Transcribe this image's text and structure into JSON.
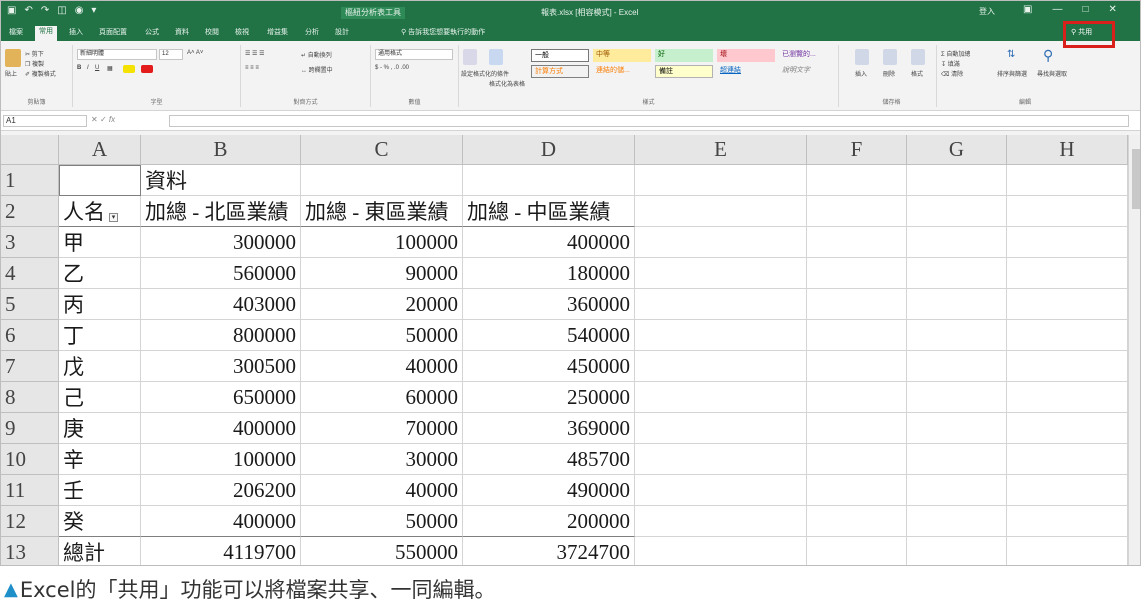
{
  "window": {
    "context_tab": "樞紐分析表工具",
    "title": "報表.xlsx [相容模式] - Excel",
    "user": "登入"
  },
  "tabs": [
    {
      "label": "檔案",
      "active": false
    },
    {
      "label": "常用",
      "active": true
    },
    {
      "label": "插入",
      "active": false
    },
    {
      "label": "頁面配置",
      "active": false
    },
    {
      "label": "公式",
      "active": false
    },
    {
      "label": "資料",
      "active": false
    },
    {
      "label": "校閱",
      "active": false
    },
    {
      "label": "檢視",
      "active": false
    },
    {
      "label": "增益集",
      "active": false
    },
    {
      "label": "分析",
      "active": false
    },
    {
      "label": "設計",
      "active": false
    }
  ],
  "tell_me": "告訴我您想要執行的動作",
  "share_label": "共用",
  "ribbon": {
    "groups": [
      "剪貼簿",
      "字型",
      "對齊方式",
      "數值",
      "樣式",
      "儲存格",
      "編輯"
    ],
    "font_name": "新細明體",
    "font_size": "12",
    "number_format": "通用格式",
    "styles": [
      "一般",
      "中等",
      "好",
      "壞",
      "已瀏覽的...",
      "計算方式",
      "連結的儲...",
      "備註",
      "超連結",
      "說明文字"
    ],
    "cut": "剪下",
    "copy": "複製",
    "format_painter": "複製格式",
    "paste": "貼上",
    "wrap": "自動換列",
    "merge": "跨欄置中",
    "conditional": "設定格式化的條件",
    "as_table": "格式化為表格",
    "insert": "插入",
    "delete": "刪除",
    "format": "格式",
    "autosum": "自動加總",
    "fill": "填滿",
    "clear": "清除",
    "sort_filter": "排序與篩選",
    "find_select": "尋找與選取"
  },
  "formula_bar": {
    "name_box": "A1",
    "fx": "fx"
  },
  "sheet": {
    "columns": [
      "A",
      "B",
      "C",
      "D",
      "E",
      "F",
      "G",
      "H"
    ],
    "rows": [
      {
        "n": "1",
        "A": "",
        "B": "資料",
        "C": "",
        "D": ""
      },
      {
        "n": "2",
        "A": "人名",
        "B": "加總 - 北區業績",
        "C": "加總 - 東區業績",
        "D": "加總 - 中區業績"
      },
      {
        "n": "3",
        "A": "甲",
        "B": "300000",
        "C": "100000",
        "D": "400000"
      },
      {
        "n": "4",
        "A": "乙",
        "B": "560000",
        "C": "90000",
        "D": "180000"
      },
      {
        "n": "5",
        "A": "丙",
        "B": "403000",
        "C": "20000",
        "D": "360000"
      },
      {
        "n": "6",
        "A": "丁",
        "B": "800000",
        "C": "50000",
        "D": "540000"
      },
      {
        "n": "7",
        "A": "戊",
        "B": "300500",
        "C": "40000",
        "D": "450000"
      },
      {
        "n": "8",
        "A": "己",
        "B": "650000",
        "C": "60000",
        "D": "250000"
      },
      {
        "n": "9",
        "A": "庚",
        "B": "400000",
        "C": "70000",
        "D": "369000"
      },
      {
        "n": "10",
        "A": "辛",
        "B": "100000",
        "C": "30000",
        "D": "485700"
      },
      {
        "n": "11",
        "A": "壬",
        "B": "206200",
        "C": "40000",
        "D": "490000"
      },
      {
        "n": "12",
        "A": "癸",
        "B": "400000",
        "C": "50000",
        "D": "200000"
      },
      {
        "n": "13",
        "A": "總計",
        "B": "4119700",
        "C": "550000",
        "D": "3724700"
      }
    ]
  },
  "caption": "Excel的「共用」功能可以將檔案共享、一同編輯。",
  "colors": {
    "excel_green": "#217346",
    "highlight": "#d9201a",
    "caption_triangle": "#1e8fc9"
  }
}
